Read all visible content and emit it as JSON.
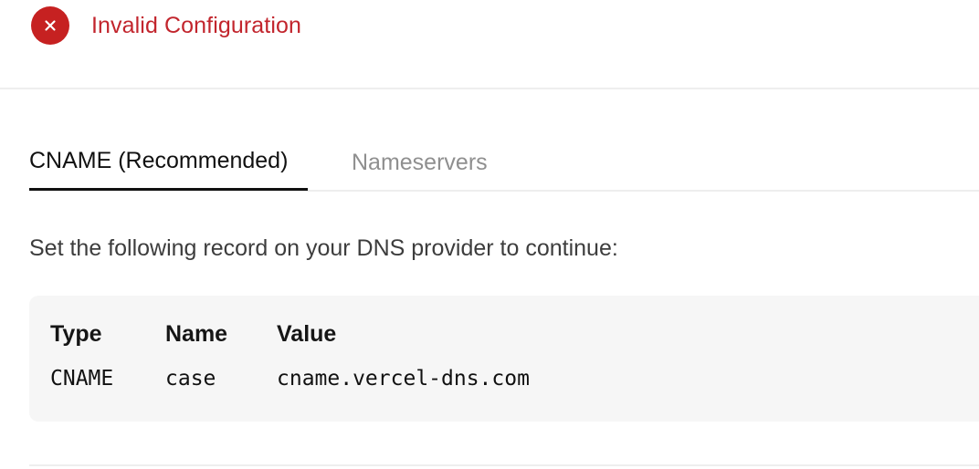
{
  "status": {
    "icon": "x-circle-icon",
    "label": "Invalid Configuration",
    "color": "#c2252d"
  },
  "tabs": [
    {
      "label": "CNAME (Recommended)",
      "active": true
    },
    {
      "label": "Nameservers",
      "active": false
    }
  ],
  "instruction": "Set the following record on your DNS provider to continue:",
  "record": {
    "headers": [
      "Type",
      "Name",
      "Value"
    ],
    "row": {
      "type": "CNAME",
      "name": "case",
      "value": "cname.vercel-dns.com"
    }
  }
}
